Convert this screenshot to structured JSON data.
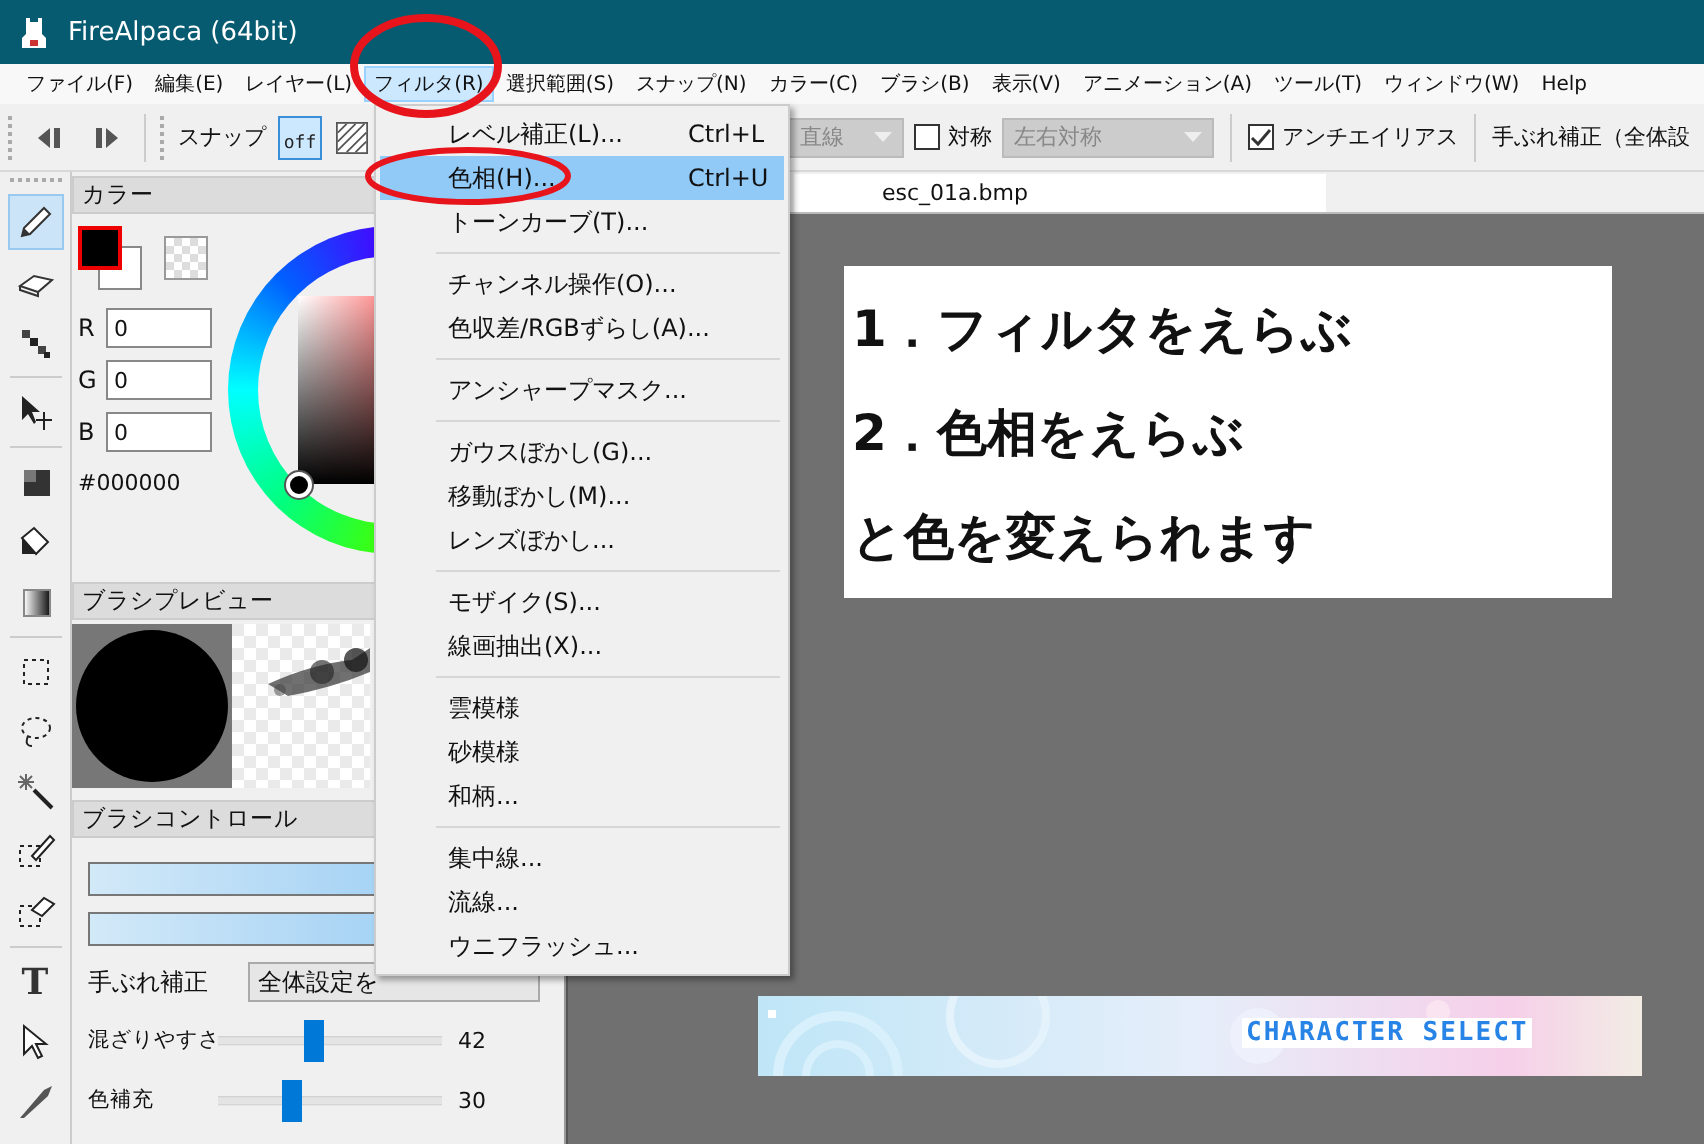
{
  "window": {
    "title": "FireAlpaca (64bit)"
  },
  "menu_bar": [
    {
      "label": "ファイル(F)",
      "selected": false
    },
    {
      "label": "編集(E)",
      "selected": false
    },
    {
      "label": "レイヤー(L)",
      "selected": false
    },
    {
      "label": "フィルタ(R)",
      "selected": true
    },
    {
      "label": "選択範囲(S)",
      "selected": false
    },
    {
      "label": "スナップ(N)",
      "selected": false
    },
    {
      "label": "カラー(C)",
      "selected": false
    },
    {
      "label": "ブラシ(B)",
      "selected": false
    },
    {
      "label": "表示(V)",
      "selected": false
    },
    {
      "label": "アニメーション(A)",
      "selected": false
    },
    {
      "label": "ツール(T)",
      "selected": false
    },
    {
      "label": "ウィンドウ(W)",
      "selected": false
    },
    {
      "label": "Help",
      "selected": false
    }
  ],
  "toolbar": {
    "snap_label": "スナップ",
    "snap_modes": [
      {
        "kind": "off",
        "label": "off",
        "selected": true
      },
      {
        "kind": "hatch",
        "selected": false
      }
    ],
    "line_dropdown": {
      "value": "直線",
      "disabled": true
    },
    "symmetry": {
      "label": "対称",
      "checked": false
    },
    "symmetry_dropdown": {
      "value": "左右対称",
      "disabled": true
    },
    "antialias": {
      "label": "アンチエイリアス",
      "checked": true
    },
    "stabilizer_label": "手ぶれ補正（全体設"
  },
  "tool_groups": [
    [
      {
        "kind": "pen",
        "selected": true
      },
      {
        "kind": "eraser",
        "selected": false
      },
      {
        "kind": "dots",
        "selected": false
      }
    ],
    [
      {
        "kind": "move",
        "selected": false
      }
    ],
    [
      {
        "kind": "fill",
        "selected": false
      },
      {
        "kind": "bucket",
        "selected": false
      },
      {
        "kind": "gradient",
        "selected": false
      }
    ],
    [
      {
        "kind": "rect-select",
        "selected": false
      },
      {
        "kind": "lasso",
        "selected": false
      },
      {
        "kind": "wand",
        "selected": false
      },
      {
        "kind": "select-pen",
        "selected": false
      },
      {
        "kind": "select-eraser",
        "selected": false
      }
    ],
    [
      {
        "kind": "text",
        "glyph": "T",
        "selected": false
      },
      {
        "kind": "pointer",
        "selected": false
      },
      {
        "kind": "knife",
        "selected": false
      }
    ]
  ],
  "color_panel": {
    "title": "カラー",
    "fields": [
      {
        "label": "R",
        "value": "0"
      },
      {
        "label": "G",
        "value": "0"
      },
      {
        "label": "B",
        "value": "0"
      }
    ],
    "hex": "#000000"
  },
  "brush_preview": {
    "title": "ブラシプレビュー"
  },
  "brush_control": {
    "title": "ブラシコントロール",
    "stabilizer": {
      "label": "手ぶれ補正",
      "value": "全体設定を"
    },
    "sliders": [
      {
        "label": "混ざりやすさ",
        "level": 0.42,
        "reading": "42"
      },
      {
        "label": "色補充",
        "level": 0.31,
        "reading": "30"
      }
    ]
  },
  "document": {
    "tab": "esc_01a.bmp",
    "lines": [
      "1．フィルタをえらぶ",
      "2．色相をえらぶ",
      "と色を変えられます"
    ],
    "banner": "CHARACTER SELECT"
  },
  "filter_menu": [
    [
      {
        "label": "レベル補正(L)...",
        "shortcut": "Ctrl+L",
        "selected": false
      },
      {
        "label": "色相(H)...",
        "shortcut": "Ctrl+U",
        "selected": true
      },
      {
        "label": "トーンカーブ(T)...",
        "selected": false
      }
    ],
    [
      {
        "label": "チャンネル操作(O)...",
        "selected": false
      },
      {
        "label": "色収差/RGBずらし(A)...",
        "selected": false
      }
    ],
    [
      {
        "label": "アンシャープマスク...",
        "selected": false
      }
    ],
    [
      {
        "label": "ガウスぼかし(G)...",
        "selected": false
      },
      {
        "label": "移動ぼかし(M)...",
        "selected": false
      },
      {
        "label": "レンズぼかし...",
        "selected": false
      }
    ],
    [
      {
        "label": "モザイク(S)...",
        "selected": false
      },
      {
        "label": "線画抽出(X)...",
        "selected": false
      }
    ],
    [
      {
        "label": "雲模様",
        "selected": false
      },
      {
        "label": "砂模様",
        "selected": false
      },
      {
        "label": "和柄...",
        "selected": false
      }
    ],
    [
      {
        "label": "集中線...",
        "selected": false
      },
      {
        "label": "流線...",
        "selected": false
      },
      {
        "label": "ウニフラッシュ...",
        "selected": false
      }
    ]
  ]
}
